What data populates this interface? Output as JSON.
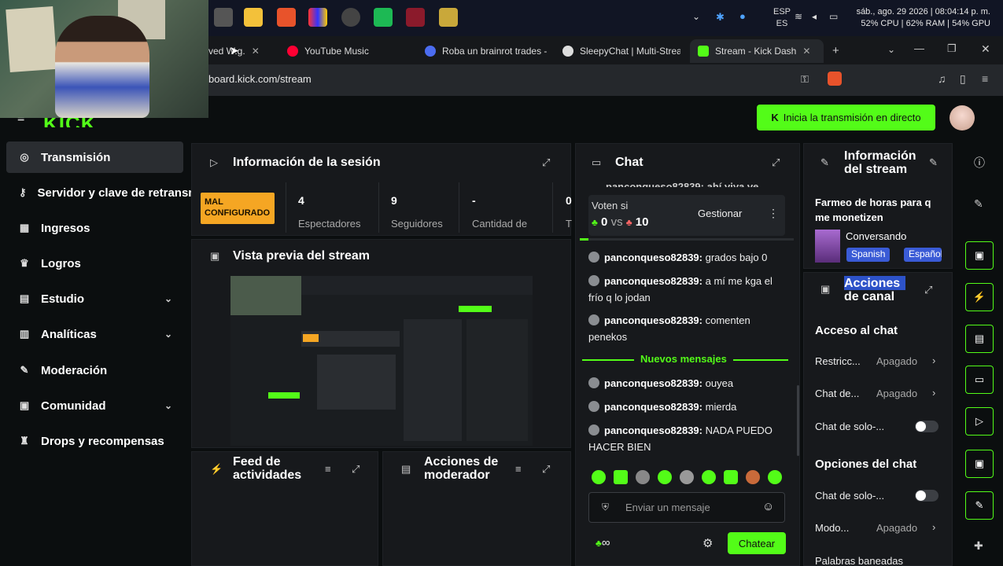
{
  "taskbar": {
    "lang_top": "ESP",
    "lang_bottom": "ES",
    "datetime": "sáb., ago. 29 2026 | 08:04:14 p. m.",
    "usage": "52% CPU | 62% RAM | 54% GPU"
  },
  "browser": {
    "tabs": [
      {
        "label": "ved W.g.",
        "color": "#c33"
      },
      {
        "label": "YouTube Music",
        "color": "#f03"
      },
      {
        "label": "Roba un brainrot trades -",
        "color": "#4b6cf0"
      },
      {
        "label": "SleepyChat | Multi-Stream",
        "color": "#ddd"
      },
      {
        "label": "Stream - Kick Dash",
        "color": "#53fc18"
      }
    ],
    "url": "board.kick.com/stream"
  },
  "header": {
    "logo": "KICK",
    "live_button": "Inicia la transmisión en directo"
  },
  "sidebar": {
    "items": [
      {
        "label": "Transmisión",
        "icon": "broadcast-icon"
      },
      {
        "label": "Servidor y clave de retransmisión",
        "icon": "key-icon"
      },
      {
        "label": "Ingresos",
        "icon": "chart-icon"
      },
      {
        "label": "Logros",
        "icon": "trophy-icon"
      },
      {
        "label": "Estudio",
        "icon": "studio-icon"
      },
      {
        "label": "Analíticas",
        "icon": "analytics-icon"
      },
      {
        "label": "Moderación",
        "icon": "wrench-icon"
      },
      {
        "label": "Comunidad",
        "icon": "community-icon"
      },
      {
        "label": "Drops y recompensas",
        "icon": "gift-icon"
      }
    ]
  },
  "session": {
    "title": "Información de la sesión",
    "badge": "MAL CONFIGURADO",
    "stats": [
      {
        "value": "4",
        "label": "Espectadores"
      },
      {
        "value": "9",
        "label": "Seguidores"
      },
      {
        "value": "-",
        "label": "Cantidad de"
      },
      {
        "value": "0",
        "label": "T"
      }
    ]
  },
  "preview": {
    "title": "Vista previa del stream"
  },
  "feed": {
    "title_1": "Feed de",
    "title_2": "actividades"
  },
  "modactions": {
    "title_1": "Acciones de",
    "title_2": "moderador"
  },
  "chat": {
    "title": "Chat",
    "truncated": "panconqueso82839: ahí viya ve",
    "vote": {
      "label": "Voten si",
      "a": "0",
      "vs": "vs",
      "b": "10",
      "manage": "Gestionar"
    },
    "messages": [
      {
        "user": "panconqueso82839:",
        "text": "grados bajo 0"
      },
      {
        "user": "panconqueso82839:",
        "text": "a mí me kga el frío q lo jodan"
      },
      {
        "user": "panconqueso82839:",
        "text": "comenten penekos"
      }
    ],
    "new_label": "Nuevos mensajes",
    "new_messages": [
      {
        "user": "panconqueso82839:",
        "text": "ouyea"
      },
      {
        "user": "panconqueso82839:",
        "text": "mierda"
      },
      {
        "user": "panconqueso82839:",
        "text": "NADA PUEDO HACER BIEN"
      }
    ],
    "placeholder": "Enviar un mensaje",
    "infinity": "∞",
    "send": "Chatear"
  },
  "streaminfo": {
    "title_1": "Información",
    "title_2": "del stream",
    "desc_1": "Farmeo de horas para q",
    "desc_2": "me monetizen",
    "category": "Conversando",
    "tag1": "Spanish",
    "tag2": "Español"
  },
  "channel": {
    "title_1": "Acciones",
    "title_2": "de canal",
    "access_heading": "Acceso al chat",
    "rows1": [
      {
        "label": "Restricc...",
        "value": "Apagado"
      },
      {
        "label": "Chat de...",
        "value": "Apagado"
      }
    ],
    "toggle1": "Chat de solo-...",
    "options_heading": "Opciones del chat",
    "toggle2": "Chat de solo-...",
    "row3": {
      "label": "Modo...",
      "value": "Apagado"
    },
    "row4": "Palabras baneadas"
  }
}
